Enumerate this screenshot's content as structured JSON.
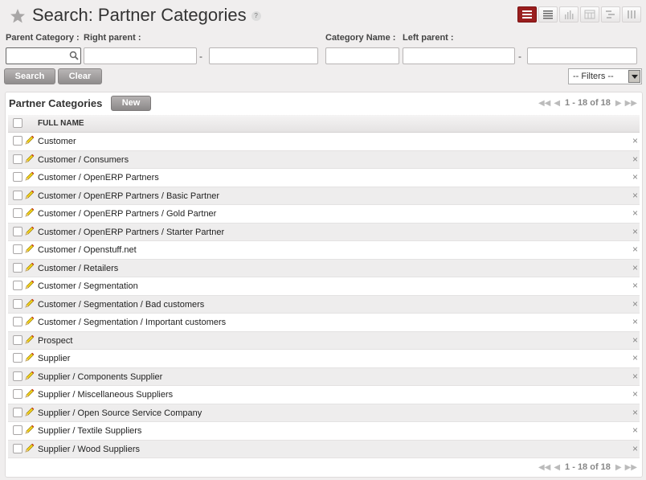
{
  "header": {
    "title": "Search: Partner Categories",
    "help": "?"
  },
  "view_switch": [
    {
      "name": "list-view-button",
      "icon": "list-icon",
      "active": true
    },
    {
      "name": "page-view-button",
      "icon": "page-icon",
      "active": false
    },
    {
      "name": "graph-view-button",
      "icon": "bar-chart-icon",
      "active": false
    },
    {
      "name": "calendar-view-button",
      "icon": "calendar-icon",
      "active": false
    },
    {
      "name": "gantt-view-button",
      "icon": "gantt-icon",
      "active": false
    },
    {
      "name": "kanban-view-button",
      "icon": "grid-icon",
      "active": false
    }
  ],
  "search": {
    "parent_category_label": "Parent Category :",
    "right_parent_label": "Right parent :",
    "category_name_label": "Category Name :",
    "left_parent_label": "Left parent :",
    "range_separator": "-",
    "search_button": "Search",
    "clear_button": "Clear",
    "filters_value": "-- Filters --"
  },
  "list": {
    "title": "Partner Categories",
    "new_button": "New",
    "pager_text": "1 - 18 of 18",
    "column_full_name": "FULL NAME",
    "rows": [
      "Customer",
      "Customer / Consumers",
      "Customer / OpenERP Partners",
      "Customer / OpenERP Partners / Basic Partner",
      "Customer / OpenERP Partners / Gold Partner",
      "Customer / OpenERP Partners / Starter Partner",
      "Customer / Openstuff.net",
      "Customer / Retailers",
      "Customer / Segmentation",
      "Customer / Segmentation / Bad customers",
      "Customer / Segmentation / Important customers",
      "Prospect",
      "Supplier",
      "Supplier / Components Supplier",
      "Supplier / Miscellaneous Suppliers",
      "Supplier / Open Source Service Company",
      "Supplier / Textile Suppliers",
      "Supplier / Wood Suppliers"
    ],
    "delete_glyph": "×"
  },
  "colors": {
    "active_view": "#9a1e1e",
    "background": "#f0eeee",
    "button_gray": "#9c9999"
  }
}
